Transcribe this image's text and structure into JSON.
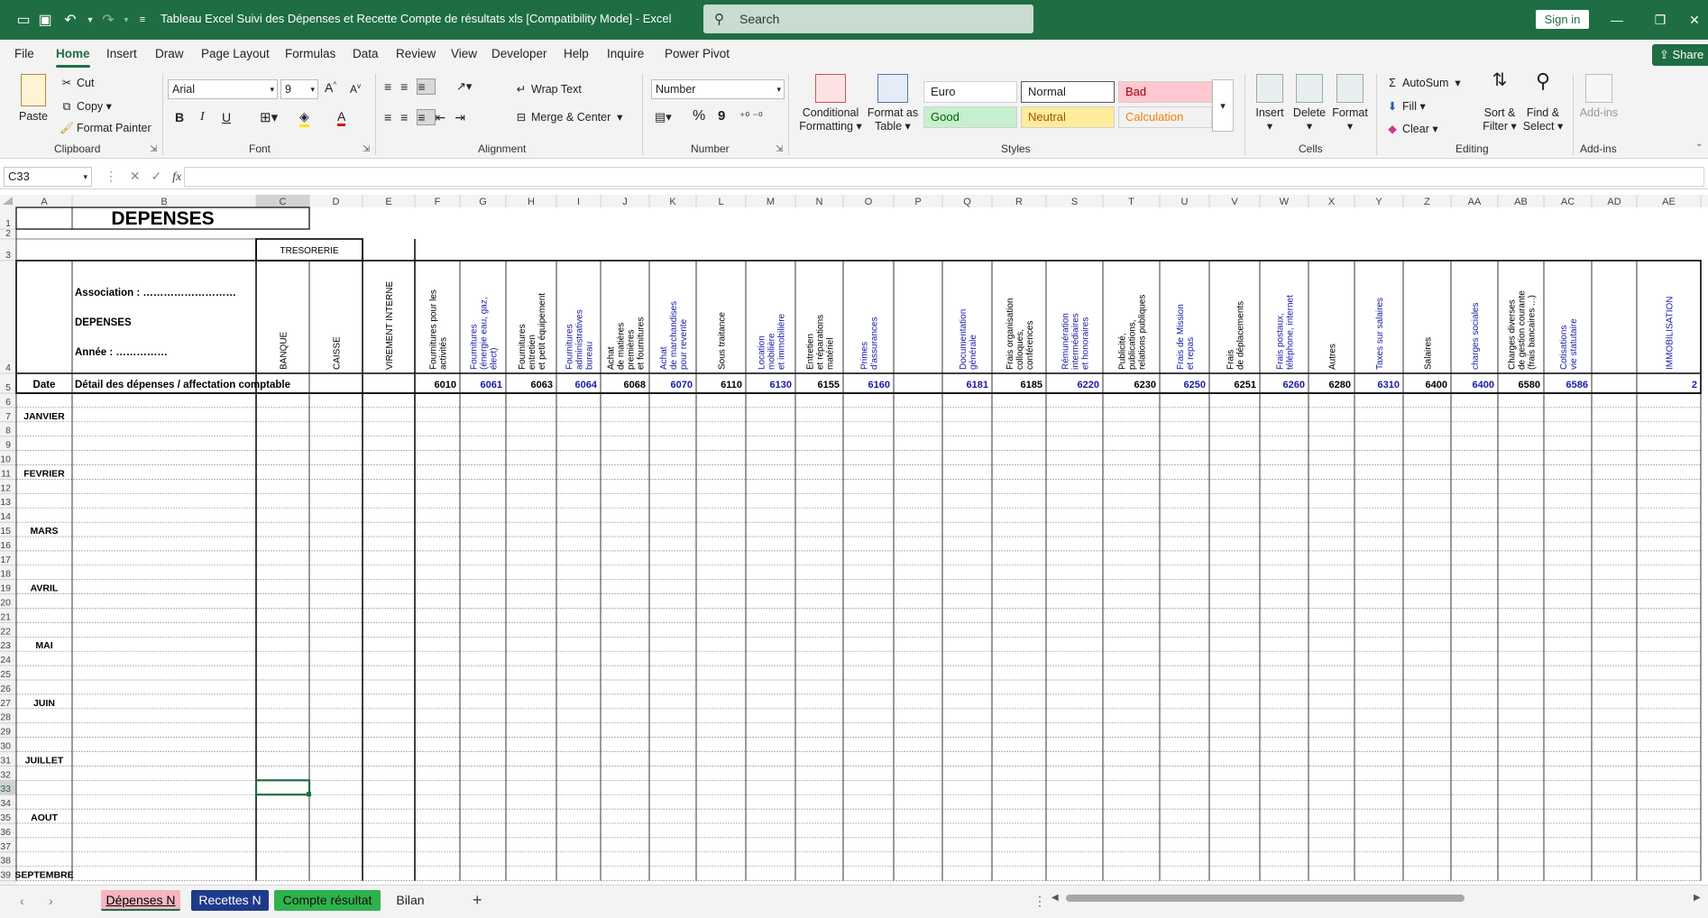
{
  "titlebar": {
    "title": "Tableau Excel Suivi des Dépenses et Recette Compte de résultats xls  [Compatibility Mode]  -  Excel",
    "search_placeholder": "Search",
    "signin": "Sign in"
  },
  "menu": {
    "items": [
      "File",
      "Home",
      "Insert",
      "Draw",
      "Page Layout",
      "Formulas",
      "Data",
      "Review",
      "View",
      "Developer",
      "Help",
      "Inquire",
      "Power Pivot"
    ],
    "share": "Share"
  },
  "ribbon": {
    "clipboard": {
      "paste": "Paste",
      "cut": "Cut",
      "copy": "Copy",
      "format_painter": "Format Painter",
      "group": "Clipboard"
    },
    "font": {
      "name": "Arial",
      "size": "9",
      "bold": "B",
      "italic": "I",
      "underline": "U",
      "group": "Font"
    },
    "alignment": {
      "wrap_text": "Wrap Text",
      "merge_center": "Merge & Center",
      "group": "Alignment"
    },
    "number": {
      "format": "Number",
      "percent": "%",
      "comma": "9",
      "group": "Number"
    },
    "styles": {
      "conditional": "Conditional",
      "conditional2": "Formatting",
      "format_as": "Format as",
      "format_as2": "Table",
      "cells": [
        {
          "label": "Euro",
          "bg": "#ffffff",
          "fg": "#222222"
        },
        {
          "label": "Normal",
          "bg": "#ffffff",
          "fg": "#222222"
        },
        {
          "label": "Bad",
          "bg": "#ffc7ce",
          "fg": "#9c0006"
        },
        {
          "label": "Good",
          "bg": "#c6efce",
          "fg": "#006100"
        },
        {
          "label": "Neutral",
          "bg": "#ffeb9c",
          "fg": "#9c5700"
        },
        {
          "label": "Calculation",
          "bg": "#f2f2f2",
          "fg": "#fa7d00"
        }
      ],
      "group": "Styles"
    },
    "cells": {
      "insert": "Insert",
      "delete": "Delete",
      "format": "Format",
      "group": "Cells"
    },
    "editing": {
      "autosum": "AutoSum",
      "fill": "Fill",
      "clear": "Clear",
      "sort": "Sort &",
      "sort2": "Filter",
      "find": "Find &",
      "find2": "Select",
      "group": "Editing"
    },
    "addins": {
      "addins": "Add-ins",
      "group": "Add-ins"
    }
  },
  "formula_bar": {
    "namebox": "C33",
    "fx": "fx",
    "content": ""
  },
  "sheet": {
    "columns": [
      "A",
      "B",
      "C",
      "D",
      "E",
      "F",
      "G",
      "H",
      "I",
      "J",
      "K",
      "L",
      "M",
      "N",
      "O",
      "P",
      "Q",
      "R",
      "S",
      "T",
      "U",
      "V",
      "W",
      "X",
      "Y",
      "Z",
      "AA",
      "AB",
      "AC",
      "AD",
      "AE"
    ],
    "rows": [
      "1",
      "2",
      "3",
      "4",
      "5",
      "6",
      "7",
      "8",
      "9",
      "10",
      "11",
      "12",
      "13",
      "14",
      "15",
      "16",
      "17",
      "18",
      "19",
      "20",
      "21",
      "22",
      "23",
      "24",
      "25",
      "26",
      "27",
      "28",
      "29",
      "30",
      "31",
      "32",
      "33",
      "34",
      "35",
      "36",
      "37",
      "38",
      "39"
    ],
    "title": "DEPENSES",
    "tresorerie": "TRESORERIE",
    "header_left": [
      "Association : ………………………",
      "DEPENSES",
      "Année : ……………"
    ],
    "date_label": "Date",
    "detail_label": "Détail des dépenses / affectation comptable",
    "banque": "BANQUE",
    "caisse": "CAISSE",
    "virement": "VIREMENT INTERNE",
    "categories": [
      {
        "col": "F",
        "label": [
          "Fournitures pour les",
          "activités"
        ],
        "code": "6010",
        "color": "#000000"
      },
      {
        "col": "G",
        "label": [
          "Fournitures",
          "(énergie eau, gaz,",
          "élect)"
        ],
        "code": "6061",
        "color": "#1a1aa6"
      },
      {
        "col": "H",
        "label": [
          "Fournitures",
          "entretien",
          "et petit équipement"
        ],
        "code": "6063",
        "color": "#000000"
      },
      {
        "col": "I",
        "label": [
          "Fournitures",
          "administratives",
          "bureau"
        ],
        "code": "6064",
        "color": "#1a1aa6"
      },
      {
        "col": "J",
        "label": [
          "Achat",
          "de matières",
          "premières",
          "et fournitures"
        ],
        "code": "6068",
        "color": "#000000"
      },
      {
        "col": "K",
        "label": [
          "Achat",
          "de marchandises",
          "pour revente"
        ],
        "code": "6070",
        "color": "#1a1aa6"
      },
      {
        "col": "L",
        "label": [
          "Sous traitance"
        ],
        "code": "6110",
        "color": "#000000"
      },
      {
        "col": "M",
        "label": [
          "Location",
          "mobilière",
          "et immobilière"
        ],
        "code": "6130",
        "color": "#1a1aa6"
      },
      {
        "col": "N",
        "label": [
          "Entretien",
          "et réparations",
          "matériel"
        ],
        "code": "6155",
        "color": "#000000"
      },
      {
        "col": "O",
        "label": [
          "Primes",
          "d'assurances"
        ],
        "code": "6160",
        "color": "#1a1aa6"
      },
      {
        "col": "P",
        "label": [],
        "code": "",
        "color": "#000000"
      },
      {
        "col": "Q",
        "label": [
          "Documentation",
          "générale"
        ],
        "code": "6181",
        "color": "#1a1aa6"
      },
      {
        "col": "R",
        "label": [
          "Frais organisation",
          "colloques,",
          "conférences"
        ],
        "code": "6185",
        "color": "#000000"
      },
      {
        "col": "S",
        "label": [
          "Rémunération",
          "intermédiaires",
          "et honoraires"
        ],
        "code": "6220",
        "color": "#1a1aa6"
      },
      {
        "col": "T",
        "label": [
          "Publicité,",
          "publications,",
          "relations publiques"
        ],
        "code": "6230",
        "color": "#000000"
      },
      {
        "col": "U",
        "label": [
          "Frais de Mission",
          "et repas"
        ],
        "code": "6250",
        "color": "#1a1aa6"
      },
      {
        "col": "V",
        "label": [
          "Frais",
          "de déplacements"
        ],
        "code": "6251",
        "color": "#000000"
      },
      {
        "col": "W",
        "label": [
          "Frais postaux,",
          "téléphone, internet"
        ],
        "code": "6260",
        "color": "#1a1aa6"
      },
      {
        "col": "X",
        "label": [
          "Autres"
        ],
        "code": "6280",
        "color": "#000000"
      },
      {
        "col": "Y",
        "label": [
          "Taxes sur salaires"
        ],
        "code": "6310",
        "color": "#1a1aa6"
      },
      {
        "col": "Z",
        "label": [
          "Salaires"
        ],
        "code": "6400",
        "color": "#000000"
      },
      {
        "col": "AA",
        "label": [
          "charges sociales"
        ],
        "code": "6400",
        "color": "#1a1aa6"
      },
      {
        "col": "AB",
        "label": [
          "Charges diverses",
          "de gestion courante",
          "(frais bancaires ...)"
        ],
        "code": "6580",
        "color": "#000000"
      },
      {
        "col": "AC",
        "label": [
          "Cotisations",
          "vie statutaire"
        ],
        "code": "6586",
        "color": "#1a1aa6"
      },
      {
        "col": "AD",
        "label": [],
        "code": "",
        "color": "#000000"
      },
      {
        "col": "AE",
        "label": [
          "IMMOBILISATION"
        ],
        "code": "2",
        "color": "#1a1aa6"
      }
    ],
    "months": [
      {
        "row": 7,
        "label": "JANVIER"
      },
      {
        "row": 11,
        "label": "FEVRIER"
      },
      {
        "row": 15,
        "label": "MARS"
      },
      {
        "row": 19,
        "label": "AVRIL"
      },
      {
        "row": 23,
        "label": "MAI"
      },
      {
        "row": 27,
        "label": "JUIN"
      },
      {
        "row": 31,
        "label": "JUILLET"
      },
      {
        "row": 35,
        "label": "AOUT"
      },
      {
        "row": 39,
        "label": "SEPTEMBRE"
      }
    ],
    "selected_cell": "C33"
  },
  "sheet_tabs": [
    {
      "label": "Dépenses N",
      "bg": "#f4b6c2",
      "fg": "#000000",
      "active": true
    },
    {
      "label": "Recettes N",
      "bg": "#1f3a8a",
      "fg": "#ffffff",
      "active": false
    },
    {
      "label": "Compte résultat",
      "bg": "#2fb24c",
      "fg": "#111111",
      "active": false
    },
    {
      "label": "Bilan",
      "bg": "transparent",
      "fg": "#222222",
      "active": false
    }
  ],
  "sheet_add": "+"
}
